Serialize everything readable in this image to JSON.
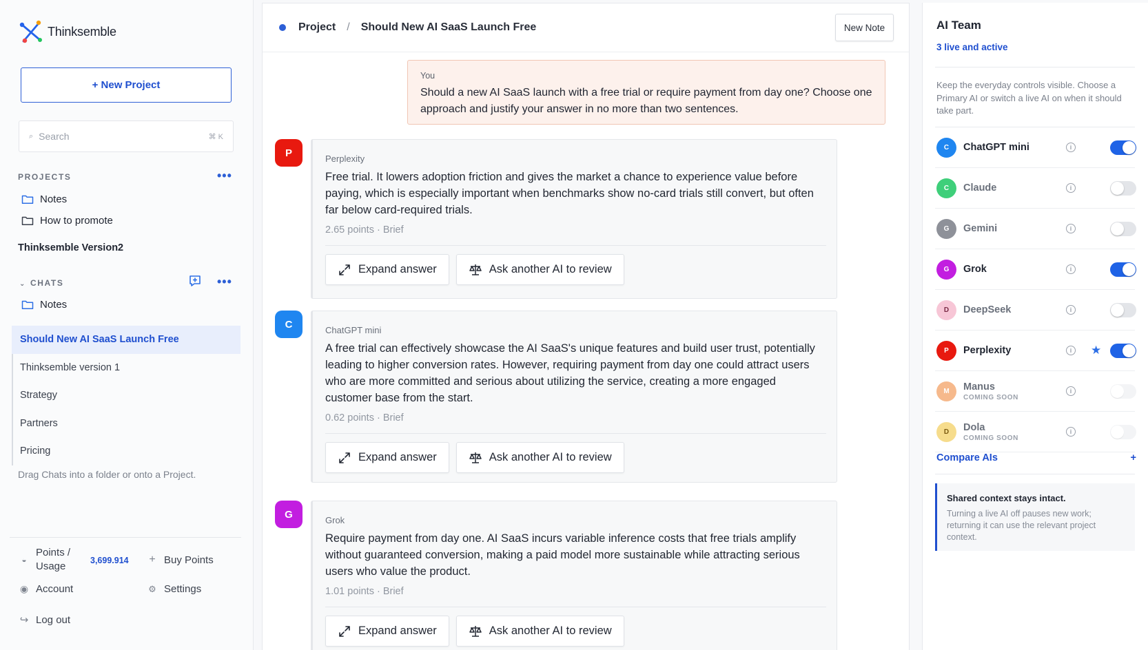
{
  "sidebar": {
    "brand": "Thinksemble",
    "new_project": "+ New Project",
    "search_placeholder": "Search",
    "search_shortcut": "⌘ K",
    "projects_label": "PROJECTS",
    "projects": [
      {
        "label": "Notes"
      },
      {
        "label": "How to promote"
      }
    ],
    "project_name": "Thinksemble Version2",
    "chats_label": "CHATS",
    "chat_folder": "Notes",
    "chats": [
      {
        "label": "Should New AI SaaS Launch Free"
      },
      {
        "label": "Thinksemble version 1"
      },
      {
        "label": "Strategy"
      },
      {
        "label": "Partners"
      },
      {
        "label": "Pricing"
      }
    ],
    "drag_hint": "Drag Chats into a folder or onto a Project.",
    "points_label": "Points / Usage",
    "points_value": "3,699.914",
    "buy_points": "Buy Points",
    "account": "Account",
    "settings": "Settings",
    "logout": "Log out"
  },
  "main": {
    "breadcrumb_root": "Project",
    "breadcrumb_sep": "/",
    "breadcrumb_current": "Should New AI SaaS Launch Free",
    "new_note": "New Note",
    "prompt": {
      "who": "You",
      "text": "Should a new AI SaaS launch with a free trial or require payment from day one? Choose one approach and justify your answer in no more than two sentences."
    },
    "expand_label": "Expand answer",
    "review_label": "Ask another AI to review",
    "answers": [
      {
        "initial": "P",
        "color": "#e8190f",
        "who": "Perplexity",
        "text": "Free trial. It lowers adoption friction and gives the market a chance to experience value before paying, which is especially important when benchmarks show no-card trials still convert, but often far below card-required trials.",
        "meta": "2.65 points · Brief"
      },
      {
        "initial": "C",
        "color": "#1f86f0",
        "who": "ChatGPT mini",
        "text": "A free trial can effectively showcase the AI SaaS's unique features and build user trust, potentially leading to higher conversion rates. However, requiring payment from day one could attract users who are more committed and serious about utilizing the service, creating a more engaged customer base from the start.",
        "meta": "0.62 points · Brief"
      },
      {
        "initial": "G",
        "color": "#c21ee0",
        "who": "Grok",
        "text": "Require payment from day one. AI SaaS incurs variable inference costs that free trials amplify without guaranteed conversion, making a paid model more sustainable while attracting serious users who value the product.",
        "meta": "1.01 points · Brief"
      }
    ]
  },
  "right": {
    "title": "AI Team",
    "subtitle": "3 live and active",
    "description": "Keep the everyday controls visible. Choose a Primary AI or switch a live AI on when it should take part.",
    "ais": [
      {
        "initial": "C",
        "name": "ChatGPT mini",
        "color": "#1f86f0",
        "on": true,
        "status": ""
      },
      {
        "initial": "C",
        "name": "Claude",
        "color": "#3fcf7a",
        "on": false,
        "status": ""
      },
      {
        "initial": "G",
        "name": "Gemini",
        "color": "#8e9199",
        "on": false,
        "status": ""
      },
      {
        "initial": "G",
        "name": "Grok",
        "color": "#c21ee0",
        "on": true,
        "status": ""
      },
      {
        "initial": "D",
        "name": "DeepSeek",
        "color": "#f7c6d6",
        "on": false,
        "status": ""
      },
      {
        "initial": "P",
        "name": "Perplexity",
        "color": "#e8190f",
        "on": true,
        "status": "",
        "primary": true
      },
      {
        "initial": "M",
        "name": "Manus",
        "color": "#f6b98c",
        "on": false,
        "status": "COMING SOON"
      },
      {
        "initial": "D",
        "name": "Dola",
        "color": "#f6dc8c",
        "on": false,
        "status": "COMING SOON"
      }
    ],
    "compare": "Compare AIs",
    "compare_plus": "+",
    "shared_title": "Shared context stays intact.",
    "shared_body": "Turning a live AI off pauses new work; returning it can use the relevant project context."
  },
  "colors": {
    "accent": "#1f4fcf",
    "toggle_on": "#1f63e6",
    "prompt_bg": "#fdf1ec"
  }
}
